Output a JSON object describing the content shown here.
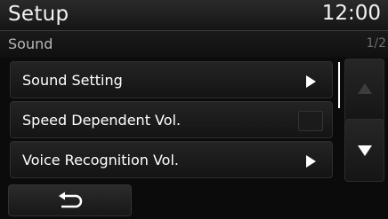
{
  "header": {
    "title": "Setup",
    "clock": "12:00"
  },
  "subheader": {
    "title": "Sound",
    "page": "1/2"
  },
  "menu": {
    "items": [
      {
        "label": "Sound Setting",
        "control": "arrow"
      },
      {
        "label": "Speed Dependent Vol.",
        "control": "toggle"
      },
      {
        "label": "Voice Recognition Vol.",
        "control": "arrow"
      }
    ]
  },
  "scroll": {
    "up_enabled": false,
    "down_enabled": true
  },
  "icons": {
    "back": "back-arrow-icon",
    "scroll_up": "triangle-up-icon",
    "scroll_down": "triangle-down-icon",
    "submenu": "play-arrow-icon"
  },
  "colors": {
    "background": "#0b0b0b",
    "text": "#ffffff",
    "disabled": "#3d3d3d"
  }
}
